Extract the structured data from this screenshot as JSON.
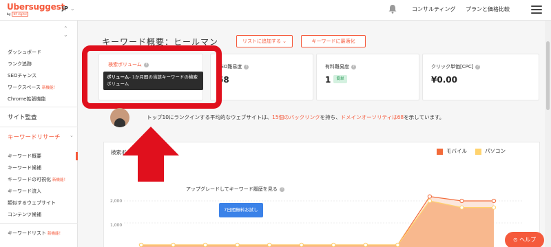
{
  "header": {
    "brand": "Ubersuggest",
    "brand_sub": "by",
    "brand_sub_mark": "NP digital",
    "language": "JP",
    "nav": [
      "コンサルティング",
      "プランと価格比較"
    ]
  },
  "sidebar": {
    "links": [
      {
        "label": "ダッシュボード",
        "badge": ""
      },
      {
        "label": "ランク追跡",
        "badge": ""
      },
      {
        "label": "SEOチャンス",
        "badge": ""
      },
      {
        "label": "ワークスペース",
        "badge": "新機能！"
      },
      {
        "label": "Chrome拡張機能",
        "badge": ""
      }
    ],
    "site_audit": "サイト監査",
    "keyword_research": "キーワードリサーチ",
    "keyword_links": [
      {
        "label": "キーワード概要",
        "badge": ""
      },
      {
        "label": "キーワード候補",
        "badge": ""
      },
      {
        "label": "キーワードの可視化",
        "badge": "新機能！"
      },
      {
        "label": "キーワード流入",
        "badge": ""
      },
      {
        "label": "類似するウェブサイト",
        "badge": ""
      },
      {
        "label": "コンテンツ候補",
        "badge": ""
      }
    ],
    "keyword_list": {
      "label": "キーワードリスト",
      "badge": "新機能！"
    }
  },
  "main": {
    "title": "キーワード概要：ヒールマン",
    "add_to_list": "リストに追加する ⌄",
    "optimize_keyword": "キーワードに最適化"
  },
  "metrics": [
    {
      "label": "検索ボリューム",
      "value": ""
    },
    {
      "label": "SEO難易度",
      "value": "58"
    },
    {
      "label": "有料難易度",
      "value": "1",
      "badge": "簡単"
    },
    {
      "label": "クリック単価[CPC]",
      "value": "¥0.00"
    }
  ],
  "tooltip": {
    "bold": "ボリューム",
    "text": "- 1か月間の当該キーワードの検索ボリューム"
  },
  "insight": {
    "prefix": "トップ10にランクインする平均的なウェブサイトは、",
    "backlinks": "15個のバックリンク",
    "middle": "を持ち、",
    "authority": "ドメインオーソリティは68",
    "suffix": "を示しています。"
  },
  "chart": {
    "title": "検索ボ",
    "legend": [
      {
        "name": "モバイル",
        "color": "#f26b3a"
      },
      {
        "name": "パソコン",
        "color": "#ffd36e"
      }
    ],
    "upgrade_text": "アップグレードしてキーワード履歴を見る",
    "trial_button": "7日間無料お試し",
    "ticks": [
      "2,000",
      "1,000"
    ]
  },
  "chart_data": {
    "type": "area",
    "x": [
      "1",
      "2",
      "3",
      "4",
      "5",
      "6",
      "7",
      "8",
      "9",
      "10",
      "11",
      "12"
    ],
    "series": [
      {
        "name": "モバイル",
        "values": [
          0,
          0,
          0,
          0,
          0,
          0,
          0,
          0,
          0,
          2200,
          2000,
          2000
        ]
      },
      {
        "name": "パソコン",
        "values": [
          0,
          0,
          0,
          0,
          0,
          0,
          0,
          0,
          0,
          2000,
          1700,
          1700
        ]
      }
    ],
    "yticks": [
      "2,000",
      "1,000"
    ]
  },
  "help": {
    "label": "ヘルプ"
  }
}
